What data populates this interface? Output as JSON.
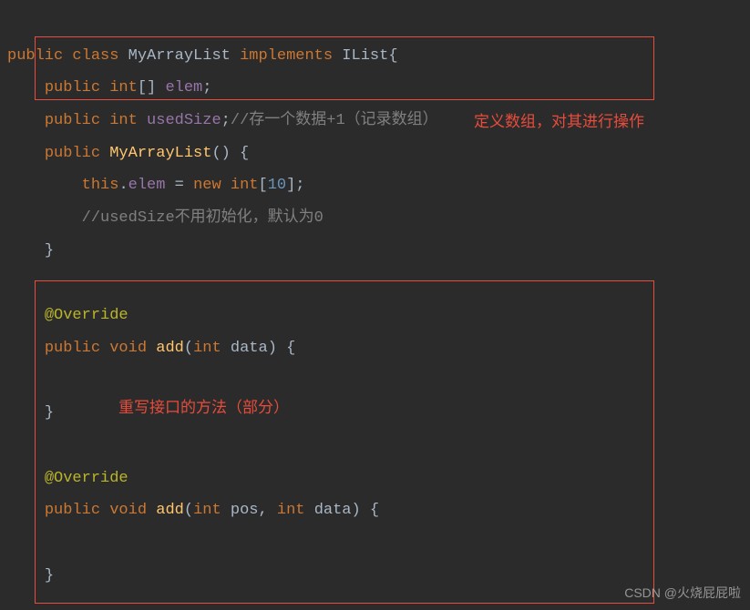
{
  "code": {
    "line1": {
      "kw1": "public",
      "kw2": "class",
      "className": "MyArrayList",
      "kw3": "implements",
      "interfaceName": "IList",
      "brace": "{"
    },
    "line2": {
      "kw1": "public",
      "type": "int",
      "brackets": "[]",
      "field": "elem",
      "semi": ";"
    },
    "line3": {
      "kw1": "public",
      "type": "int",
      "field": "usedSize",
      "semi": ";",
      "comment": "//存一个数据+1（记录数组）"
    },
    "line4": {
      "kw1": "public",
      "method": "MyArrayList",
      "parens": "() {"
    },
    "line5": {
      "kw1": "this",
      "dot": ".",
      "field": "elem",
      "eq": " = ",
      "kw2": "new",
      "type": "int",
      "bracket1": "[",
      "num": "10",
      "bracket2": "]",
      "semi": ";"
    },
    "line6": {
      "commentPrefix": "//",
      "commentIdent": "usedSize",
      "commentRest": "不用初始化，默认为0"
    },
    "line7": {
      "brace": "}"
    },
    "line9": {
      "annotation": "@Override"
    },
    "line10": {
      "kw1": "public",
      "kw2": "void",
      "method": "add",
      "paren1": "(",
      "type1": "int",
      "param1": "data",
      "paren2": ") {"
    },
    "line12": {
      "brace": "}"
    },
    "line14": {
      "annotation": "@Override"
    },
    "line15": {
      "kw1": "public",
      "kw2": "void",
      "method": "add",
      "paren1": "(",
      "type1": "int",
      "param1": "pos",
      "comma": ", ",
      "type2": "int",
      "param2": "data",
      "paren2": ") {"
    },
    "line17": {
      "brace": "}"
    }
  },
  "annotations": {
    "red1": "定义数组，对其进行操作",
    "red2": "重写接口的方法（部分）"
  },
  "watermark": "CSDN @火烧屁屁啦"
}
